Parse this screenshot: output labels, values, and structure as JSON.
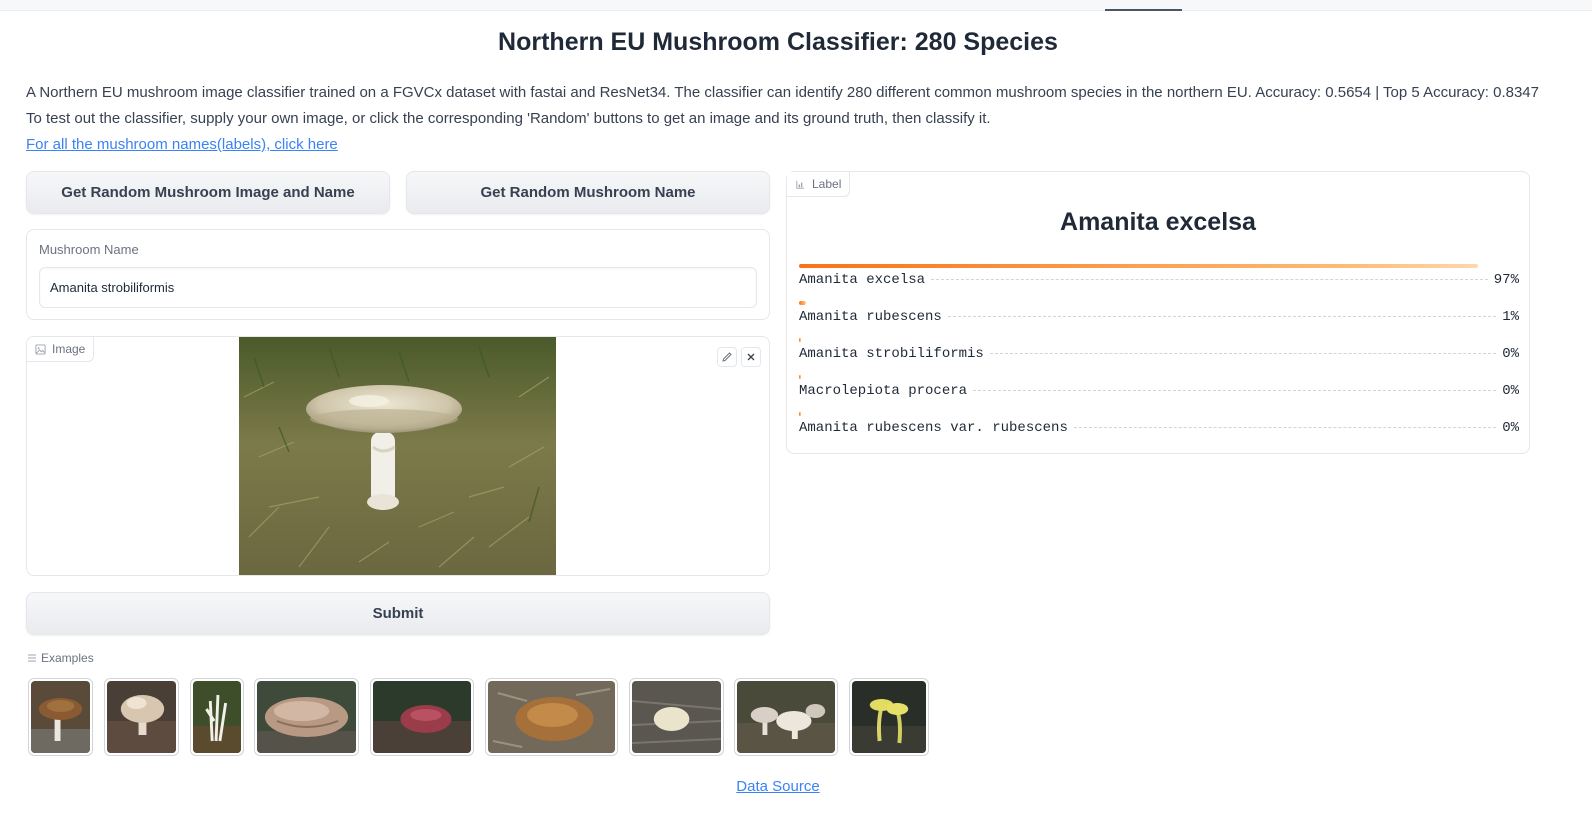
{
  "app": {
    "title": "Northern EU Mushroom Classifier: 280 Species"
  },
  "description": {
    "line1": "A Northern EU mushroom image classifier trained on a FGVCx dataset with fastai and ResNet34. The classifier can identify 280 different common mushroom species in the northern EU. Accuracy: 0.5654 | Top 5 Accuracy: 0.8347",
    "line2": "To test out the classifier, supply your own image, or click the corresponding 'Random' buttons to get an image and its ground truth, then classify it.",
    "link": "For all the mushroom names(labels), click here"
  },
  "buttons": {
    "random_image_and_name": "Get Random Mushroom Image and Name",
    "random_name": "Get Random Mushroom Name",
    "submit": "Submit"
  },
  "name_field": {
    "label": "Mushroom Name",
    "value": "Amanita strobiliformis"
  },
  "image_panel": {
    "tag": "Image",
    "edit_icon": "pencil-icon",
    "close_icon": "close-icon"
  },
  "label_panel": {
    "tag": "Label",
    "top_label": "Amanita excelsa",
    "confidences": [
      {
        "label": "Amanita excelsa",
        "value": "97%",
        "fraction": 0.97
      },
      {
        "label": "Amanita rubescens",
        "value": "1%",
        "fraction": 0.01
      },
      {
        "label": "Amanita strobiliformis",
        "value": "0%",
        "fraction": 0.002
      },
      {
        "label": "Macrolepiota procera",
        "value": "0%",
        "fraction": 0.002
      },
      {
        "label": "Amanita rubescens var. rubescens",
        "value": "0%",
        "fraction": 0.001
      }
    ],
    "bar_color": "#f97316"
  },
  "examples": {
    "label": "Examples",
    "count": 9
  },
  "footer": {
    "link": "Data Source"
  }
}
